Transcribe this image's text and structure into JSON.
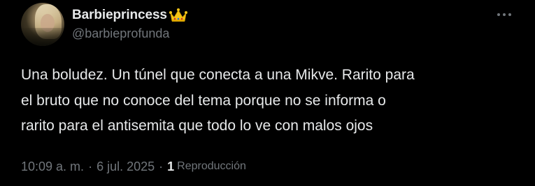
{
  "author": {
    "display_name": "Barbieprincess",
    "badge_emoji_icon": "crown-icon",
    "handle": "@barbieprofunda"
  },
  "tweet": {
    "lines": [
      "Una boludez. Un túnel que conecta a una Mikve. Rarito para",
      "el bruto que no conoce del tema porque no se informa o",
      "rarito para el antisemita que todo lo ve con malos ojos"
    ]
  },
  "meta": {
    "time": "10:09 a. m.",
    "separator": "·",
    "date": "6 jul. 2025",
    "views_count": "1",
    "views_label": "Reproducción"
  },
  "colors": {
    "background": "#000000",
    "primary_text": "#e7e9ea",
    "secondary_text": "#71767b",
    "crown": "#f5c518"
  }
}
